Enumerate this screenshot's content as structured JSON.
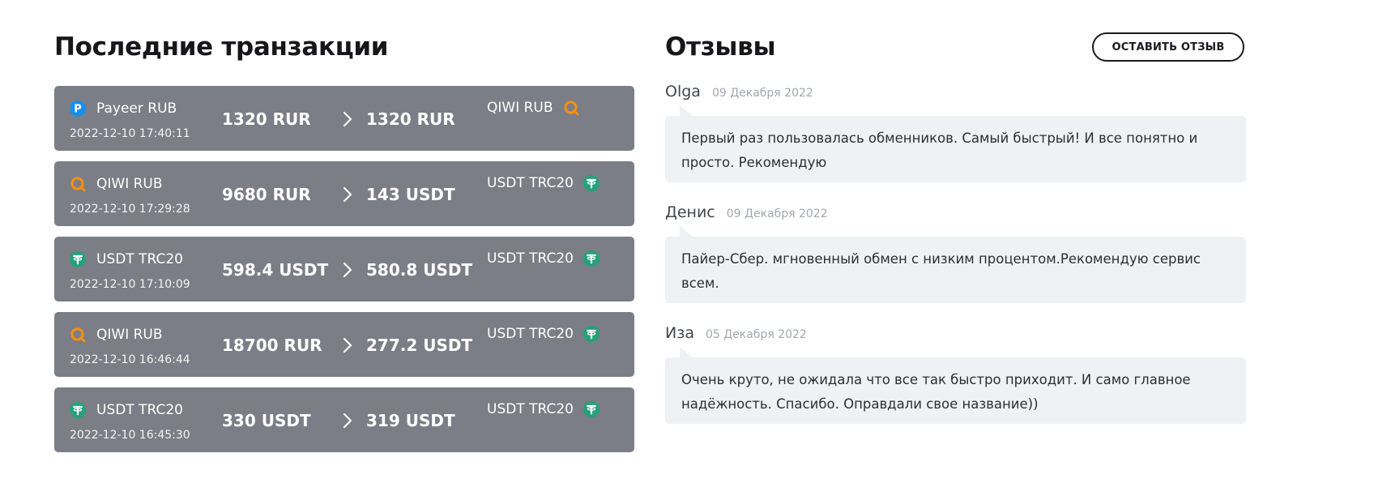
{
  "transactions_title": "Последние транзакции",
  "reviews_title": "Отзывы",
  "leave_review_label": "ОСТАВИТЬ ОТЗЫВ",
  "colors": {
    "row_bg": "#7b7e86",
    "payeer": "#1a8ee8",
    "qiwi": "#f39014",
    "usdt": "#26a17b",
    "review_bg": "#f0f1f4"
  },
  "transactions": [
    {
      "from": "Payeer RUB",
      "from_icon": "payeer-icon",
      "date": "2022-12-10 17:40:11",
      "amount_from": "1320 RUR",
      "amount_to": "1320 RUR",
      "to": "QIWI RUB",
      "to_icon": "qiwi-icon"
    },
    {
      "from": "QIWI RUB",
      "from_icon": "qiwi-icon",
      "date": "2022-12-10 17:29:28",
      "amount_from": "9680 RUR",
      "amount_to": "143 USDT",
      "to": "USDT TRC20",
      "to_icon": "tether-icon"
    },
    {
      "from": "USDT TRC20",
      "from_icon": "tether-icon",
      "date": "2022-12-10 17:10:09",
      "amount_from": "598.4 USDT",
      "amount_to": "580.8 USDT",
      "to": "USDT TRC20",
      "to_icon": "tether-icon"
    },
    {
      "from": "QIWI RUB",
      "from_icon": "qiwi-icon",
      "date": "2022-12-10 16:46:44",
      "amount_from": "18700 RUR",
      "amount_to": "277.2 USDT",
      "to": "USDT TRC20",
      "to_icon": "tether-icon"
    },
    {
      "from": "USDT TRC20",
      "from_icon": "tether-icon",
      "date": "2022-12-10 16:45:30",
      "amount_from": "330 USDT",
      "amount_to": "319 USDT",
      "to": "USDT TRC20",
      "to_icon": "tether-icon"
    }
  ],
  "reviews": [
    {
      "author": "Olga",
      "date": "09 Декабря 2022",
      "text": "Первый раз пользовалась обменников. Самый быстрый! И все понятно и просто. Рекомендую"
    },
    {
      "author": "Денис",
      "date": "09 Декабря 2022",
      "text": "Пайер-Сбер. мгновенный обмен с низким процентом.Рекомендую сервис всем."
    },
    {
      "author": "Иза",
      "date": "05 Декабря 2022",
      "text": "Очень круто, не ожидала что все так быстро приходит. И само главное надёжность. Спасибо. Оправдали свое название))"
    }
  ]
}
